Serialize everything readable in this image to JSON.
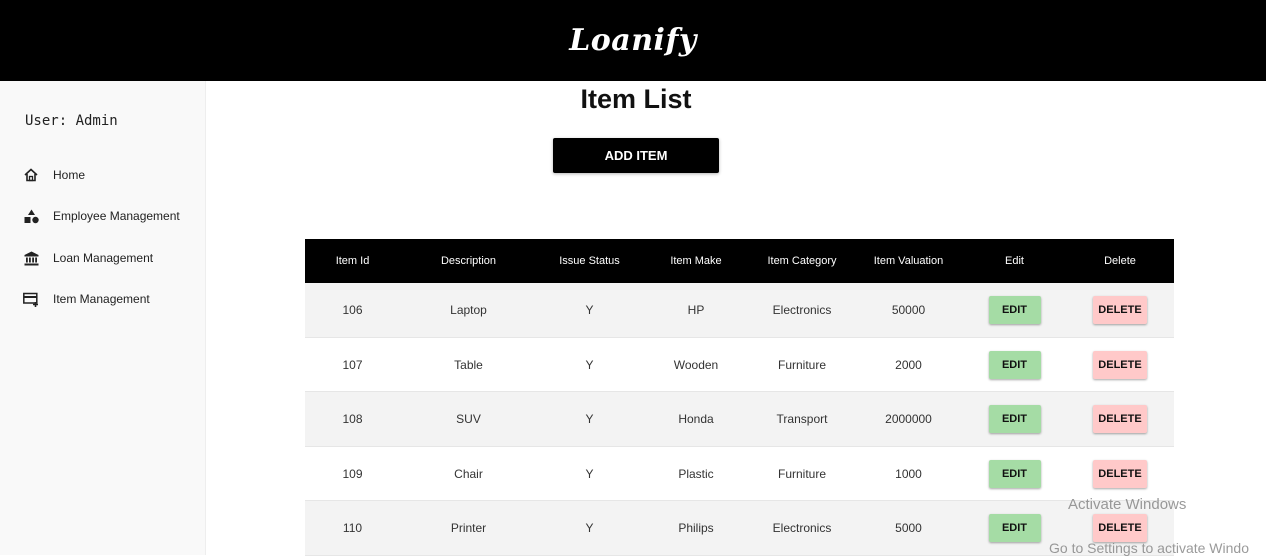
{
  "header": {
    "brand": "Loanify"
  },
  "sidebar": {
    "user_label": "User: Admin",
    "items": [
      {
        "label": "Home",
        "icon": "home-icon"
      },
      {
        "label": "Employee Management",
        "icon": "shapes-icon"
      },
      {
        "label": "Loan Management",
        "icon": "bank-icon"
      },
      {
        "label": "Item Management",
        "icon": "card-add-icon"
      }
    ]
  },
  "main": {
    "title": "Item List",
    "add_button": "ADD ITEM"
  },
  "table": {
    "headers": [
      "Item Id",
      "Description",
      "Issue Status",
      "Item Make",
      "Item Category",
      "Item Valuation",
      "Edit",
      "Delete"
    ],
    "rows": [
      [
        "106",
        "Laptop",
        "Y",
        "HP",
        "Electronics",
        "50000"
      ],
      [
        "107",
        "Table",
        "Y",
        "Wooden",
        "Furniture",
        "2000"
      ],
      [
        "108",
        "SUV",
        "Y",
        "Honda",
        "Transport",
        "2000000"
      ],
      [
        "109",
        "Chair",
        "Y",
        "Plastic",
        "Furniture",
        "1000"
      ],
      [
        "110",
        "Printer",
        "Y",
        "Philips",
        "Electronics",
        "5000"
      ]
    ],
    "edit_label": "EDIT",
    "delete_label": "DELETE"
  },
  "overlay": {
    "activate_title": "Activate Windows",
    "activate_sub": "Go to Settings to activate Windo"
  }
}
